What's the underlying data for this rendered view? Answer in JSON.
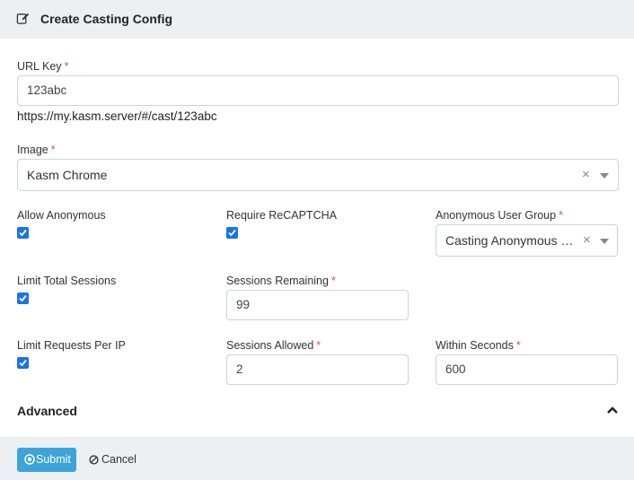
{
  "header": {
    "title": "Create Casting Config",
    "icon": "edit-icon"
  },
  "form": {
    "url_key": {
      "label": "URL Key",
      "required": "*",
      "value": "123abc",
      "hint": "https://my.kasm.server/#/cast/123abc"
    },
    "image": {
      "label": "Image",
      "required": "*",
      "value": "Kasm Chrome",
      "clear": "×"
    },
    "allow_anonymous": {
      "label": "Allow Anonymous",
      "checked": true
    },
    "require_recaptcha": {
      "label": "Require ReCAPTCHA",
      "checked": true
    },
    "anon_group": {
      "label": "Anonymous User Group",
      "required": "*",
      "value": "Casting Anonymous U...",
      "clear": "×"
    },
    "limit_sessions": {
      "label": "Limit Total Sessions",
      "checked": true
    },
    "sessions_remaining": {
      "label": "Sessions Remaining",
      "required": "*",
      "value": "99"
    },
    "limit_requests": {
      "label": "Limit Requests Per IP",
      "checked": true
    },
    "sessions_allowed": {
      "label": "Sessions Allowed",
      "required": "*",
      "value": "2"
    },
    "within_seconds": {
      "label": "Within Seconds",
      "required": "*",
      "value": "600"
    }
  },
  "advanced": {
    "label": "Advanced"
  },
  "footer": {
    "submit_label": "Submit",
    "cancel_label": "Cancel"
  },
  "colors": {
    "accent": "#3da4d9",
    "checkbox": "#1a73e8",
    "required": "#d9534f",
    "header_bg": "#edf0f3"
  }
}
